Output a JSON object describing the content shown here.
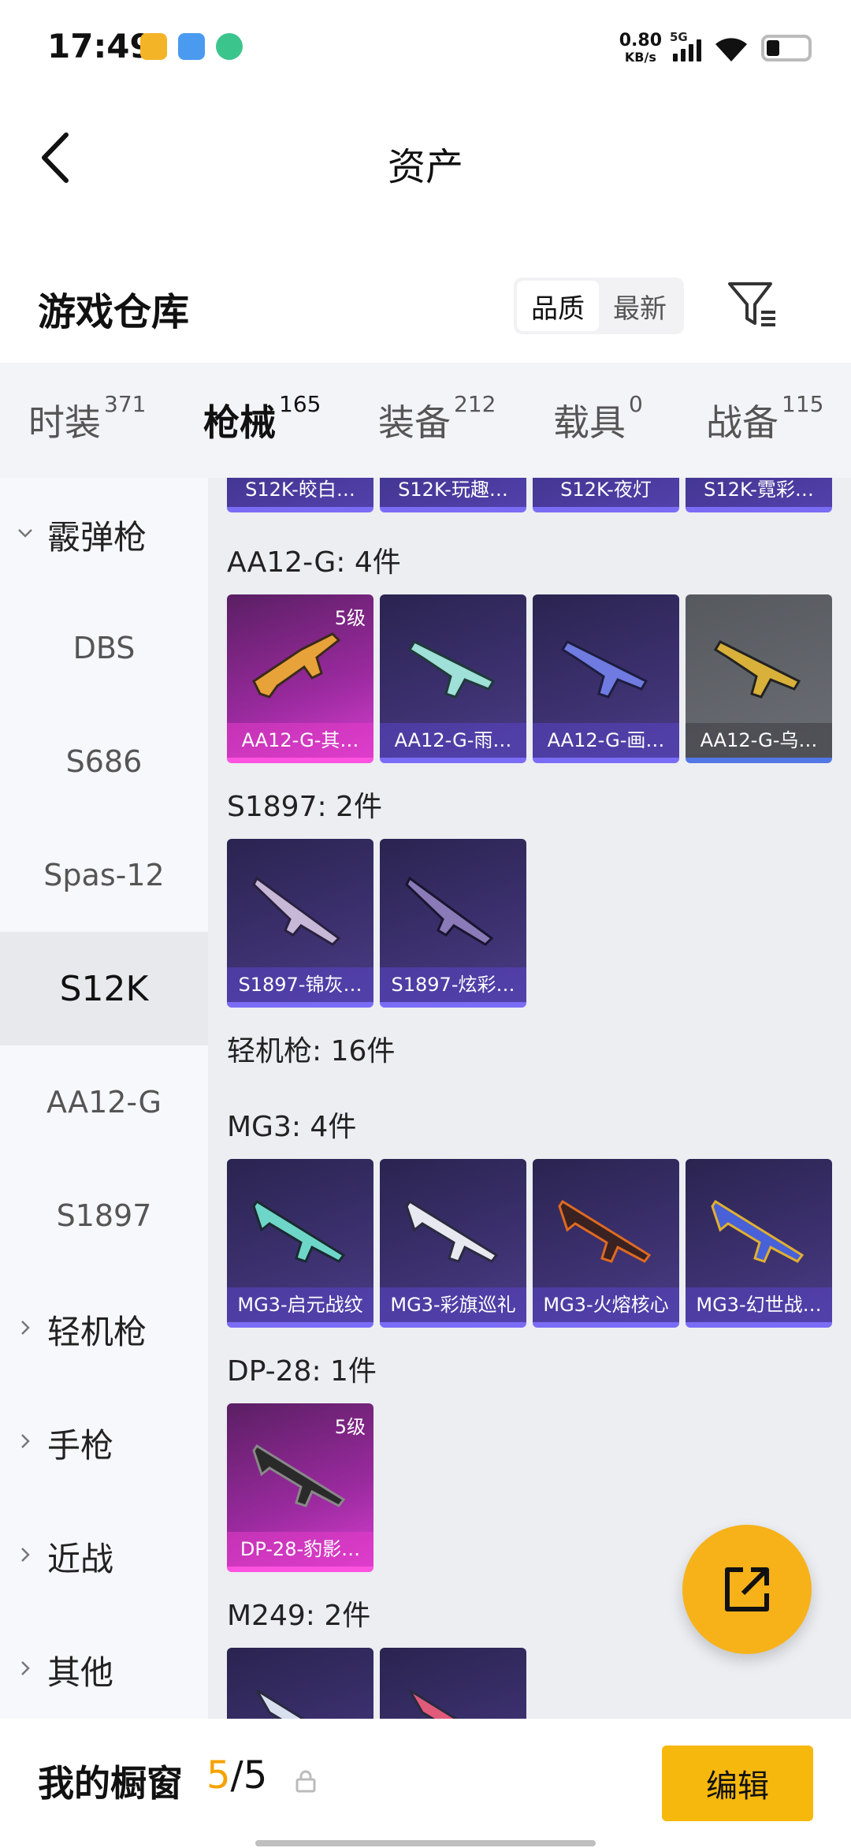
{
  "status_bar": {
    "time": "17:49",
    "net_speed_value": "0.80",
    "net_speed_unit": "KB/s",
    "network": "5G",
    "battery_level": 0.25
  },
  "header": {
    "title": "资产"
  },
  "section": {
    "title": "游戏仓库",
    "sort_quality": "品质",
    "sort_newest": "最新"
  },
  "tabs": [
    {
      "label": "时装",
      "count": "371"
    },
    {
      "label": "枪械",
      "count": "165"
    },
    {
      "label": "装备",
      "count": "212"
    },
    {
      "label": "载具",
      "count": "0"
    },
    {
      "label": "战备",
      "count": "115"
    }
  ],
  "sidebar": [
    {
      "label": "霰弹枪",
      "type": "group",
      "expanded": true
    },
    {
      "label": "DBS",
      "type": "sub"
    },
    {
      "label": "S686",
      "type": "sub"
    },
    {
      "label": "Spas-12",
      "type": "sub"
    },
    {
      "label": "S12K",
      "type": "sub",
      "active": true
    },
    {
      "label": "AA12-G",
      "type": "sub"
    },
    {
      "label": "S1897",
      "type": "sub"
    },
    {
      "label": "轻机枪",
      "type": "group"
    },
    {
      "label": "手枪",
      "type": "group"
    },
    {
      "label": "近战",
      "type": "group"
    },
    {
      "label": "其他",
      "type": "group"
    }
  ],
  "content": {
    "s12k_strip": [
      "S12K-皎白…",
      "S12K-玩趣…",
      "S12K-夜灯",
      "S12K-霓彩…"
    ],
    "groups": [
      {
        "title": "AA12-G: 4件",
        "items": [
          {
            "name": "AA12-G-其…",
            "level": "5级",
            "quality": "q5"
          },
          {
            "name": "AA12-G-雨…",
            "quality": "purple"
          },
          {
            "name": "AA12-G-画…",
            "quality": "purple"
          },
          {
            "name": "AA12-G-乌…",
            "quality": "grey"
          }
        ]
      },
      {
        "title": "S1897: 2件",
        "items": [
          {
            "name": "S1897-锦灰…",
            "quality": "purple"
          },
          {
            "name": "S1897-炫彩…",
            "quality": "purple"
          }
        ]
      },
      {
        "title": "轻机枪: 16件",
        "items": []
      },
      {
        "title": "MG3: 4件",
        "items": [
          {
            "name": "MG3-启元战纹",
            "quality": "purple"
          },
          {
            "name": "MG3-彩旗巡礼",
            "quality": "purple"
          },
          {
            "name": "MG3-火熔核心",
            "quality": "purple"
          },
          {
            "name": "MG3-幻世战…",
            "quality": "purple"
          }
        ]
      },
      {
        "title": "DP-28: 1件",
        "items": [
          {
            "name": "DP-28-豹影…",
            "level": "5级",
            "quality": "q5"
          }
        ]
      },
      {
        "title": "M249: 2件",
        "items": []
      }
    ]
  },
  "bottom_bar": {
    "label": "我的橱窗",
    "current": "5",
    "separator": "/",
    "total": "5",
    "edit_label": "编辑"
  },
  "colors": {
    "accent": "#f5a300",
    "button": "#f7b80e",
    "purple_quality": "#7b6cf5",
    "gold_quality": "#ff52e0"
  }
}
